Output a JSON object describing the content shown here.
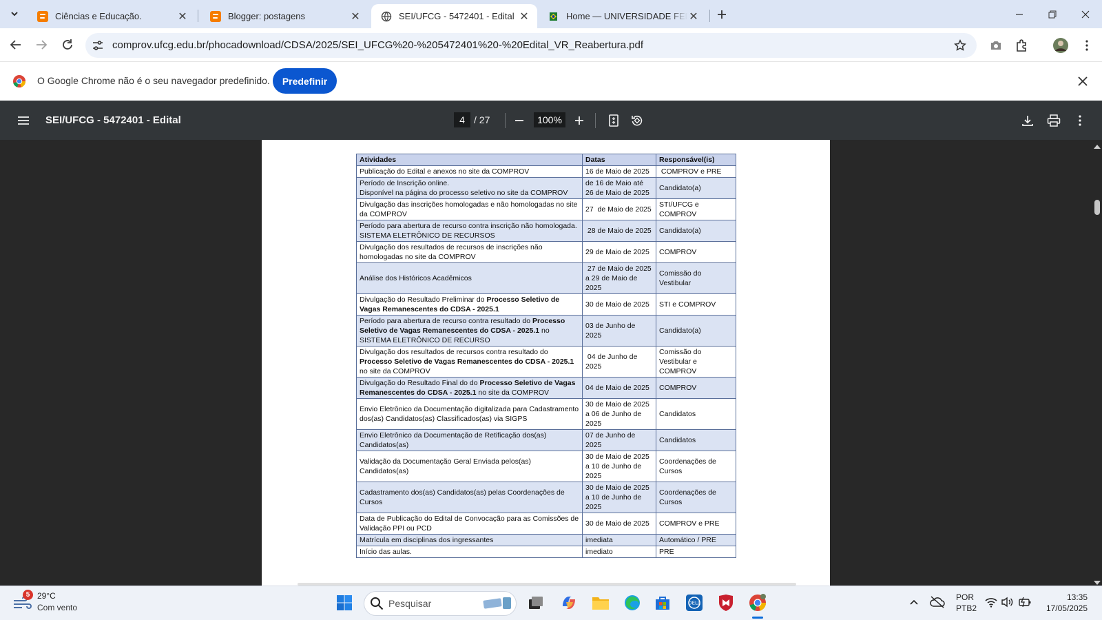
{
  "browser": {
    "tabs": [
      {
        "title": "Ciências e Educação.",
        "favicon": "blogger-icon",
        "active": false
      },
      {
        "title": "Blogger: postagens",
        "favicon": "blogger-icon",
        "active": false
      },
      {
        "title": "SEI/UFCG - 5472401 - Edital",
        "favicon": "globe-icon",
        "active": true
      },
      {
        "title": "Home — UNIVERSIDADE FEDERAL",
        "favicon": "brazil-flag-icon",
        "active": false
      }
    ],
    "url": "comprov.ufcg.edu.br/phocadownload/CDSA/2025/SEI_UFCG%20-%205472401%20-%20Edital_VR_Reabertura.pdf"
  },
  "infobar": {
    "message": "O Google Chrome não é o seu navegador predefinido.",
    "button_label": "Predefinir"
  },
  "pdf": {
    "title": "SEI/UFCG - 5472401 - Edital",
    "current_page": "4",
    "total_pages": "/ 27",
    "zoom": "100%"
  },
  "schedule": {
    "headers": [
      "Atividades",
      "Datas",
      "Responsável(is)"
    ],
    "rows": [
      {
        "activity": "Publicação do Edital e anexos no site da COMPROV",
        "date": "16 de Maio de 2025",
        "resp": " COMPROV e PRE"
      },
      {
        "activity": "Período de Inscrição online.\nDisponível na página do processo seletivo no site da COMPROV",
        "date": "de 16 de Maio até 26 de Maio de 2025",
        "resp": "Candidato(a)"
      },
      {
        "activity": "Divulgação das inscrições homologadas e não homologadas no site da COMPROV",
        "date": "27  de Maio de 2025",
        "resp": "STI/UFCG e COMPROV"
      },
      {
        "activity": "Período para abertura de recurso contra inscrição não homologada. SISTEMA ELETRÔNICO DE RECURSOS",
        "date": " 28 de Maio de 2025",
        "resp": "Candidato(a)"
      },
      {
        "activity": "Divulgação dos resultados de recursos de inscrições não homologadas no site da COMPROV",
        "date": "29 de Maio de 2025",
        "resp": "COMPROV"
      },
      {
        "activity": "Análise dos Históricos Acadêmicos",
        "date": " 27 de Maio de 2025 a 29 de Maio de 2025",
        "resp": "Comissão do Vestibular"
      },
      {
        "activity_pre": "Divulgação do Resultado Preliminar do ",
        "activity_bold": "Processo Seletivo de Vagas Remanescentes do CDSA - 2025.1",
        "activity_post": "",
        "date": "30 de Maio de 2025",
        "resp": "STI e COMPROV"
      },
      {
        "activity_pre": "Período para abertura de recurso contra resultado do ",
        "activity_bold": "Processo Seletivo de Vagas Remanescentes do CDSA - 2025.1",
        "activity_post": " no SISTEMA ELETRÔNICO DE RECURSO",
        "date": "03 de Junho de 2025",
        "resp": "Candidato(a)"
      },
      {
        "activity_pre": "Divulgação dos resultados de recursos contra resultado do ",
        "activity_bold": "Processo Seletivo de Vagas Remanescentes do CDSA - 2025.1",
        "activity_post": " no site da COMPROV",
        "date": " 04 de Junho de 2025",
        "resp": "Comissão do Vestibular e COMPROV"
      },
      {
        "activity_pre": "Divulgação do Resultado Final do do ",
        "activity_bold": "Processo Seletivo de Vagas Remanescentes do CDSA - 2025.1",
        "activity_post": " no site da COMPROV",
        "date": "04 de Maio de 2025",
        "resp": "COMPROV"
      },
      {
        "activity": "Envio Eletrônico da Documentação digitalizada para Cadastramento dos(as) Candidatos(as) Classificados(as) via SIGPS",
        "date": "30 de Maio de 2025 a 06 de Junho de 2025",
        "resp": "Candidatos"
      },
      {
        "activity": "Envio Eletrônico da Documentação de Retificação dos(as) Candidatos(as)",
        "date": "07 de Junho de 2025",
        "resp": "Candidatos"
      },
      {
        "activity": "Validação da Documentação Geral Enviada pelos(as) Candidatos(as)",
        "date": "30 de Maio de 2025 a 10 de Junho de 2025",
        "resp": "Coordenações de Cursos"
      },
      {
        "activity": "Cadastramento dos(as) Candidatos(as) pelas Coordenações de Cursos",
        "date": "30 de Maio de 2025 a 10 de Junho de 2025",
        "resp": "Coordenações de Cursos"
      },
      {
        "activity": "Data de Publicação do Edital de Convocação para as Comissões de Validação PPI ou PCD",
        "date": "30 de Maio de 2025",
        "resp": "COMPROV e PRE"
      },
      {
        "activity": "Matrícula em disciplinas dos ingressantes",
        "date": "imediata",
        "resp": "Automático / PRE"
      },
      {
        "activity": "Início das aulas.",
        "date": "imediato",
        "resp": "PRE"
      }
    ]
  },
  "taskbar": {
    "weather_badge": "5",
    "temperature": "29°C",
    "condition": "Com vento",
    "search_placeholder": "Pesquisar",
    "lang_line1": "POR",
    "lang_line2": "PTB2",
    "time": "13:35",
    "date": "17/05/2025"
  },
  "colors": {
    "tab_strip": "#dce5f5",
    "accent_button": "#0b57d0",
    "pdf_toolbar": "#323639",
    "viewer_background": "#282828",
    "table_header": "#c9d3ec",
    "table_shaded_row": "#dbe3f3"
  }
}
